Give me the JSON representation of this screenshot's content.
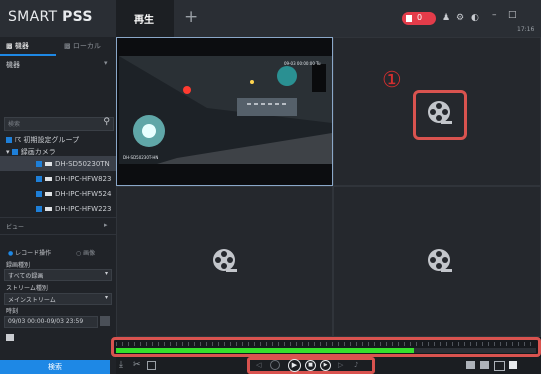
{
  "app": {
    "logo_light": "SMART ",
    "logo_bold": "PSS"
  },
  "tabs": [
    {
      "label": "再生"
    }
  ],
  "titlebar": {
    "alarm_count": "0",
    "time": "17:16"
  },
  "sidebar": {
    "tab_device": "機器",
    "tab_local": "ローカル",
    "device_filter": "機器",
    "search_placeholder": "検索",
    "tree": [
      {
        "label": "初期設定グループ"
      },
      {
        "label": "録画カメラ"
      },
      {
        "label": "DH-SD50230TN"
      },
      {
        "label": "DH-IPC-HFW823"
      },
      {
        "label": "DH-IPC-HFW524"
      },
      {
        "label": "DH-IPC-HFW223"
      }
    ],
    "view_label": "ビュー",
    "record_type_options": [
      "レコード操作",
      "画像"
    ],
    "video_type_label": "録画種別",
    "video_type_value": "すべての録画",
    "stream_type_label": "ストリーム種別",
    "stream_type_value": "メインストリーム",
    "time_label": "時刻",
    "time_value": "09/03 00:00-09/03 23:59",
    "search_button": "検索"
  },
  "video": {
    "overlay_top": "09-03 00:00:00 Tu",
    "overlay_bottom": "DH-SD50230T-HN"
  },
  "annotation": {
    "number": "①"
  },
  "timeline": {
    "progress": 0.71
  },
  "colors": {
    "accent": "#1e88e5",
    "alert": "#d9534f",
    "timeline_bar": "#35e02c"
  }
}
